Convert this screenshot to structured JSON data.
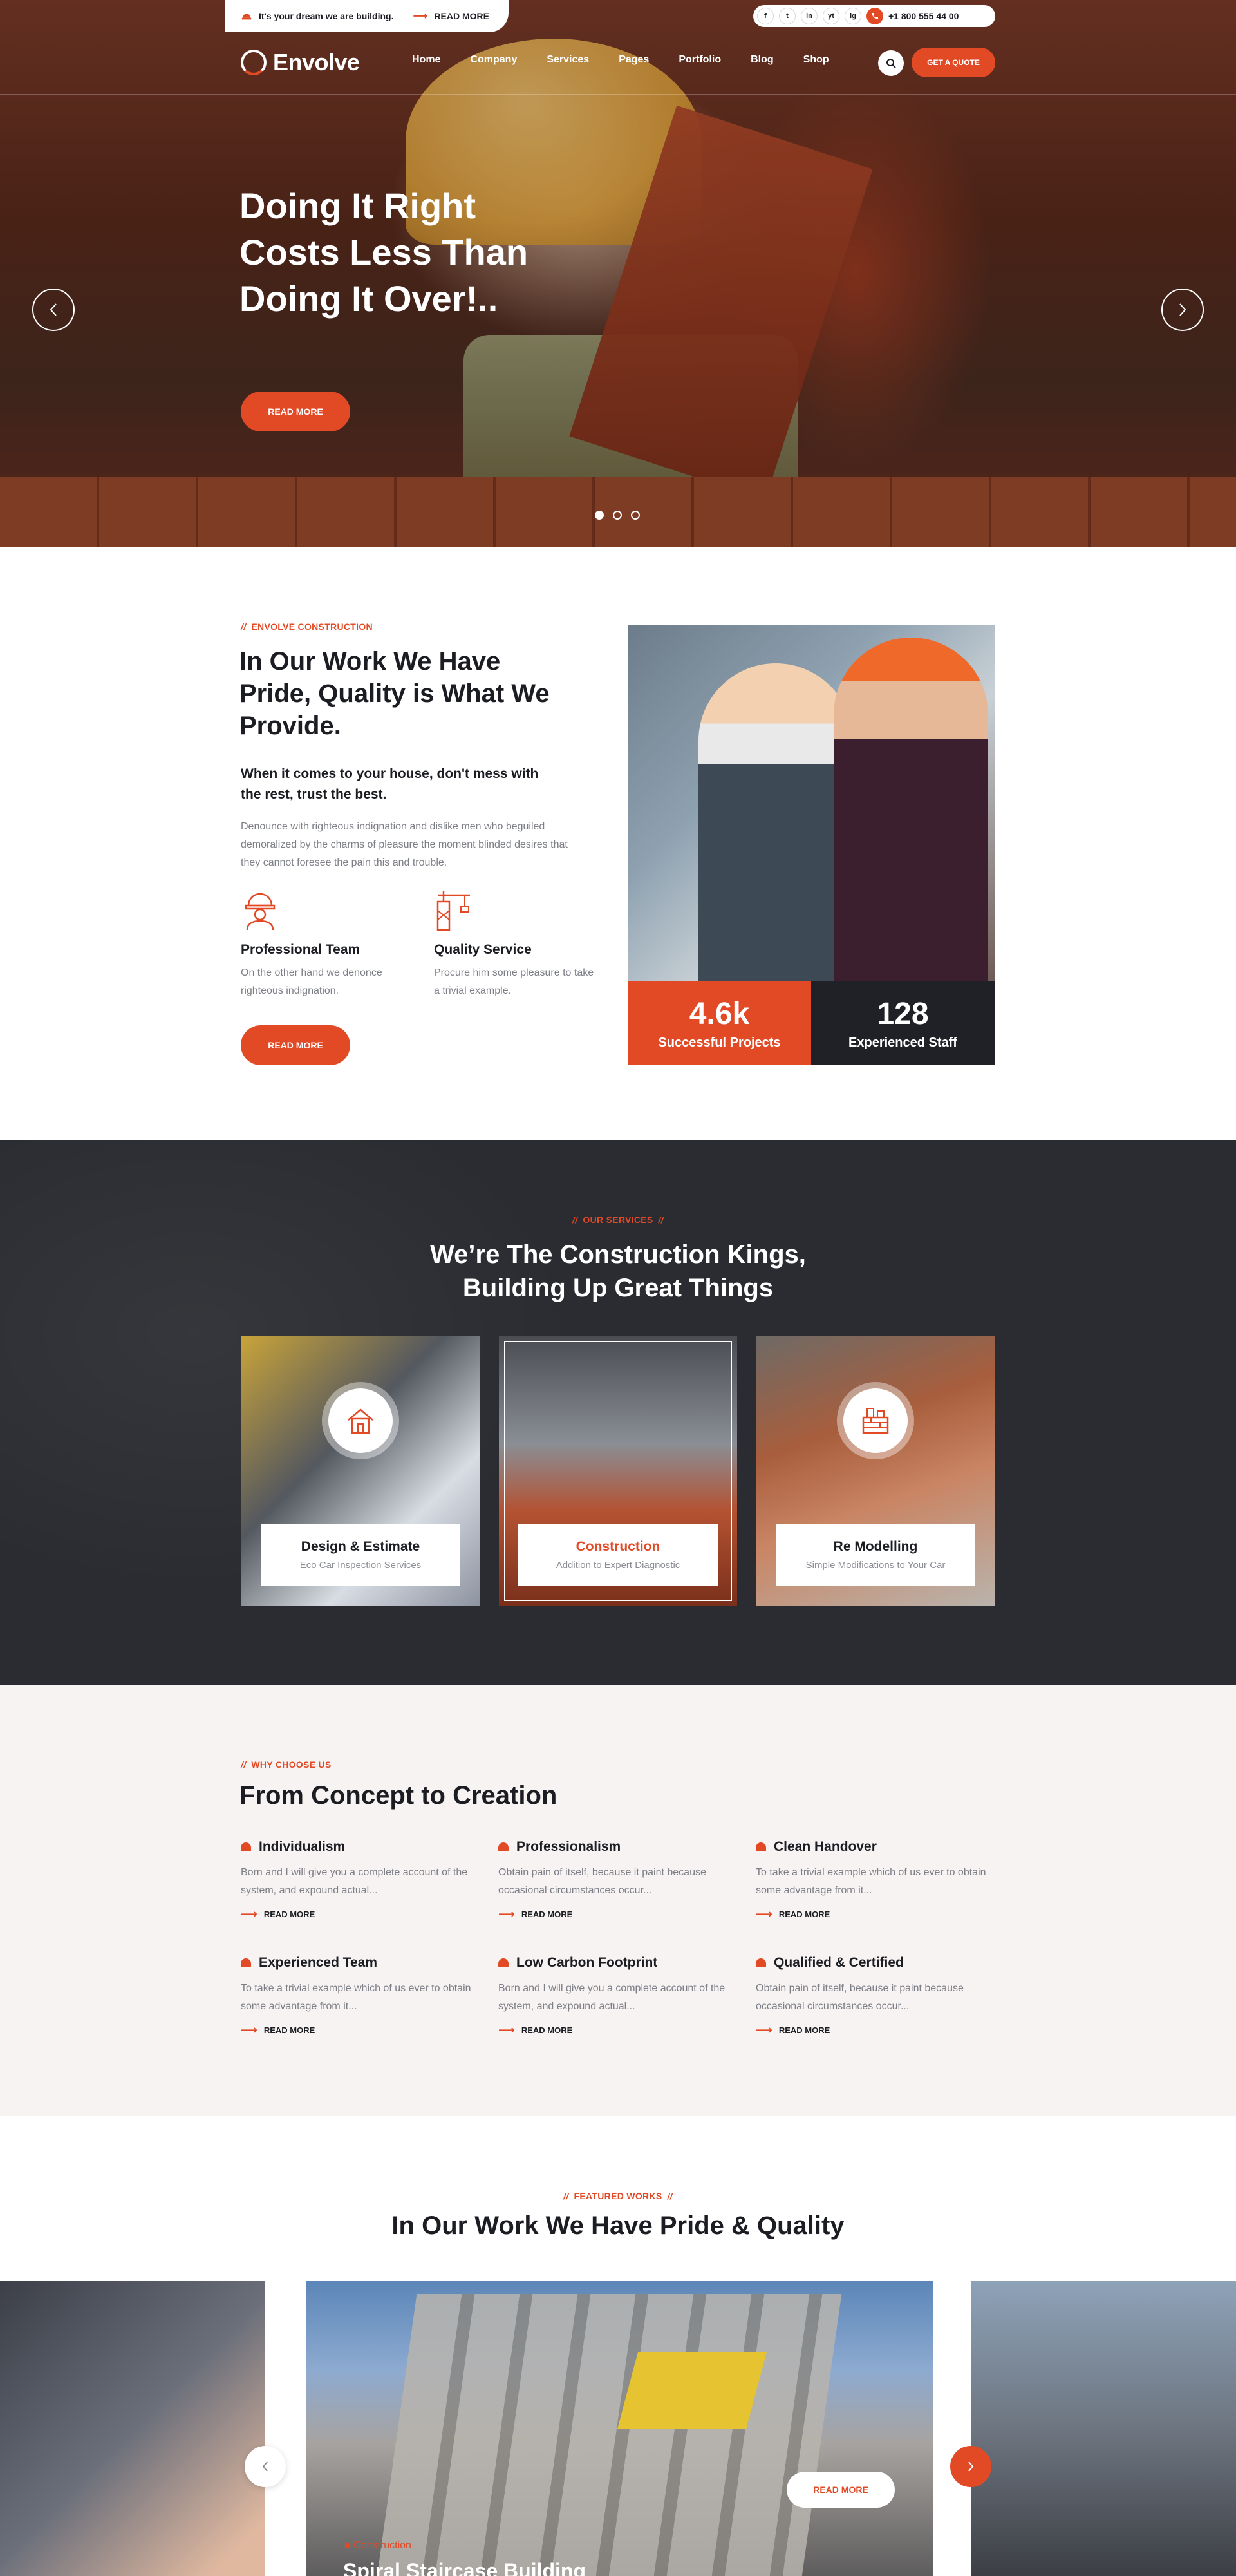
{
  "topbar": {
    "announcement": "It's your dream we are building.",
    "read_more": "READ MORE",
    "social": [
      "f",
      "t",
      "in",
      "yt",
      "ig"
    ],
    "phone": "+1 800 555 44 00"
  },
  "brand": {
    "name": "Envolve"
  },
  "nav": {
    "items": [
      "Home",
      "Company",
      "Services",
      "Pages",
      "Portfolio",
      "Blog",
      "Shop"
    ],
    "quote_button": "GET A QUOTE"
  },
  "hero": {
    "title": "Doing It Right Costs Less Than Doing It Over!..",
    "button": "READ MORE",
    "slide_count": 3,
    "active_slide": 1
  },
  "about": {
    "tagline": "ENVOLVE CONSTRUCTION",
    "title": "In Our Work We Have Pride, Quality is What We Provide.",
    "subtitle": "When it comes to your house, don't mess with the rest, trust the best.",
    "body": "Denounce with righteous indignation and dislike men who beguiled demoralized by the charms of pleasure the moment blinded desires that they cannot foresee the pain this and trouble.",
    "features": [
      {
        "title": "Professional Team",
        "text": "On the other hand we denonce righteous indignation."
      },
      {
        "title": "Quality Service",
        "text": "Procure him some pleasure to take a trivial example."
      }
    ],
    "button": "READ MORE",
    "stats": [
      {
        "value": "4.6k",
        "label": "Successful Projects"
      },
      {
        "value": "128",
        "label": "Experienced Staff"
      }
    ]
  },
  "services": {
    "tagline": "OUR SERVICES",
    "title": "We’re The Construction Kings, Building Up Great Things",
    "cards": [
      {
        "name": "Design & Estimate",
        "desc": "Eco Car Inspection Services"
      },
      {
        "name": "Construction",
        "desc": "Addition to Expert Diagnostic"
      },
      {
        "name": "Re Modelling",
        "desc": "Simple Modifications to Your Car"
      }
    ]
  },
  "why": {
    "tagline": "WHY CHOOSE US",
    "title": "From Concept to Creation",
    "items": [
      {
        "title": "Individualism",
        "text": "Born and I will give you a complete account of the system, and expound actual...",
        "link": "READ MORE"
      },
      {
        "title": "Professionalism",
        "text": "Obtain pain of itself, because it paint because occasional circumstances occur...",
        "link": "READ MORE"
      },
      {
        "title": "Clean Handover",
        "text": "To take a trivial example which of us ever to obtain some advantage from it...",
        "link": "READ MORE"
      },
      {
        "title": "Experienced Team",
        "text": "To take a trivial example which of us ever to obtain some advantage from it...",
        "link": "READ MORE"
      },
      {
        "title": "Low Carbon Footprint",
        "text": "Born and I will give you a complete account of the system, and expound actual...",
        "link": "READ MORE"
      },
      {
        "title": "Qualified & Certified",
        "text": "Obtain pain of itself, because it paint because occasional circumstances occur...",
        "link": "READ MORE"
      }
    ]
  },
  "featured": {
    "tagline": "FEATURED WORKS",
    "title": "In Our Work We Have Pride & Quality",
    "current": {
      "category": "Construction",
      "name": "Spiral Staircase Building",
      "button": "READ MORE"
    }
  },
  "colors": {
    "accent": "#e24a26",
    "dark": "#1b1d23",
    "muted": "#7d7f87"
  }
}
